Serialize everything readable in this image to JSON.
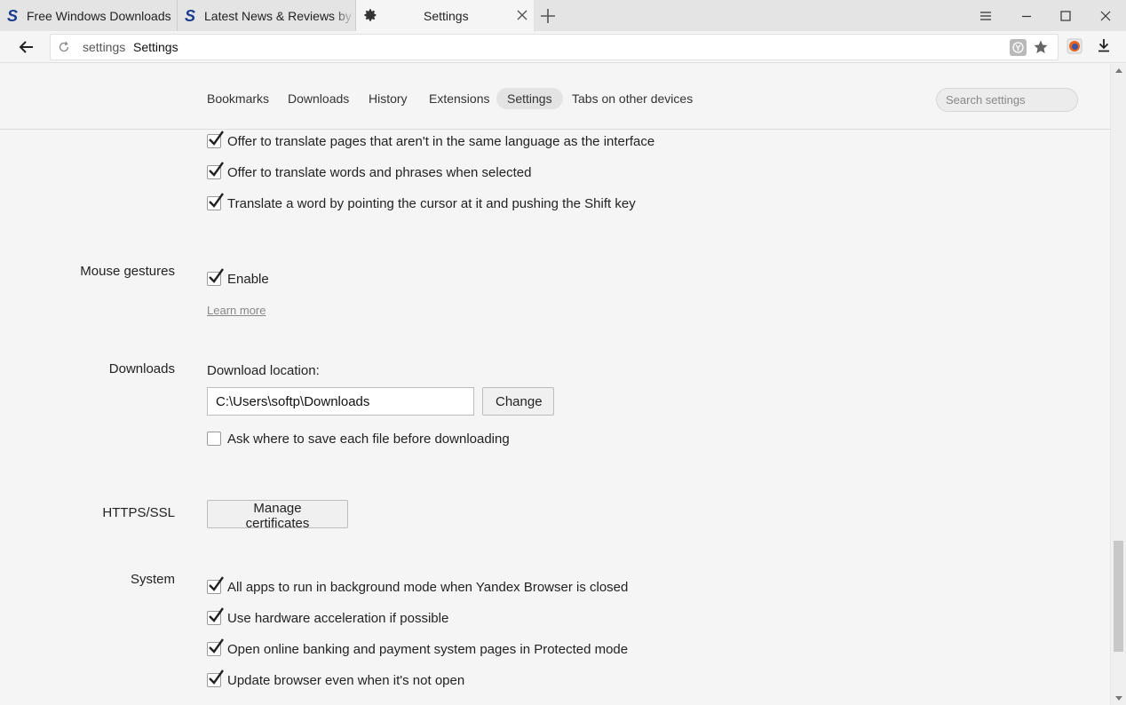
{
  "tabs": [
    {
      "title": "Free Windows Downloads"
    },
    {
      "title": "Latest News & Reviews by Softpedia"
    },
    {
      "title": "Settings"
    }
  ],
  "address": {
    "domain": "settings",
    "title": "Settings"
  },
  "nav": {
    "items": [
      "Bookmarks",
      "Downloads",
      "History",
      "Extensions",
      "Settings",
      "Tabs on other devices"
    ],
    "selected": "Settings",
    "search_placeholder": "Search settings"
  },
  "translate": {
    "options": [
      {
        "label": "Offer to translate pages that aren't in the same language as the interface",
        "checked": true
      },
      {
        "label": "Offer to translate words and phrases when selected",
        "checked": true
      },
      {
        "label": "Translate a word by pointing the cursor at it and pushing the Shift key",
        "checked": true
      }
    ]
  },
  "mouse_gestures": {
    "label": "Mouse gestures",
    "enable_label": "Enable",
    "enabled": true,
    "learn_more": "Learn more"
  },
  "downloads": {
    "label": "Downloads",
    "location_label": "Download location:",
    "path": "C:\\Users\\softp\\Downloads",
    "change_button": "Change",
    "ask_label": "Ask where to save each file before downloading",
    "ask_checked": false
  },
  "https": {
    "label": "HTTPS/SSL",
    "manage_button": "Manage certificates"
  },
  "system": {
    "label": "System",
    "options": [
      {
        "label": "All apps to run in background mode when Yandex Browser is closed",
        "checked": true
      },
      {
        "label": "Use hardware acceleration if possible",
        "checked": true
      },
      {
        "label": "Open online banking and payment system pages in Protected mode",
        "checked": true
      },
      {
        "label": "Update browser even when it's not open",
        "checked": true
      }
    ]
  },
  "colors": {
    "check_mark": "#222222",
    "brand_s": "#1a3c8f"
  }
}
